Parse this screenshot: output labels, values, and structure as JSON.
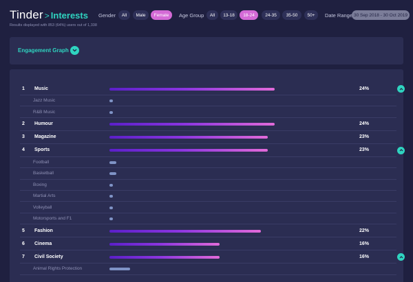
{
  "header": {
    "brand": "Tinder",
    "separator": ">",
    "section": "Interests",
    "subtitle": "Results displayed with 853 (64%) users out of 1,338"
  },
  "filters": {
    "gender_label": "Gender",
    "gender_options": [
      "All",
      "Male",
      "Female"
    ],
    "gender_selected": "Female",
    "age_label": "Age Group",
    "age_options": [
      "All",
      "13-18",
      "18-24",
      "24-35",
      "35-50",
      "50+"
    ],
    "age_selected": "18-24",
    "date_label": "Date Range",
    "date_value": "30 Sep 2018 - 30 Oct 2019"
  },
  "engagement": {
    "title": "Engagement Graph",
    "toggle_icon": "chevron-down-icon"
  },
  "colors": {
    "accent": "#2fd4c0",
    "active_pill": "#d46ad6",
    "bar_start": "#5b1fc9",
    "bar_end": "#e26ad9",
    "sub_bar": "#7f93c6"
  },
  "interests": [
    {
      "type": "main",
      "rank": "1",
      "name": "Music",
      "value": 0.24,
      "pct": "24%",
      "expanded": true
    },
    {
      "type": "sub",
      "name": "Jazz Music",
      "value": 0.005
    },
    {
      "type": "sub",
      "name": "R&B Music",
      "value": 0.005
    },
    {
      "type": "main",
      "rank": "2",
      "name": "Humour",
      "value": 0.24,
      "pct": "24%"
    },
    {
      "type": "main",
      "rank": "3",
      "name": "Magazine",
      "value": 0.23,
      "pct": "23%"
    },
    {
      "type": "main",
      "rank": "4",
      "name": "Sports",
      "value": 0.23,
      "pct": "23%",
      "expanded": true
    },
    {
      "type": "sub",
      "name": "Football",
      "value": 0.01
    },
    {
      "type": "sub",
      "name": "Basketball",
      "value": 0.01
    },
    {
      "type": "sub",
      "name": "Boxing",
      "value": 0.005
    },
    {
      "type": "sub",
      "name": "Martial Arts",
      "value": 0.005
    },
    {
      "type": "sub",
      "name": "Volleyball",
      "value": 0.005
    },
    {
      "type": "sub",
      "name": "Motorsports and F1",
      "value": 0.005
    },
    {
      "type": "main",
      "rank": "5",
      "name": "Fashion",
      "value": 0.22,
      "pct": "22%"
    },
    {
      "type": "main",
      "rank": "6",
      "name": "Cinema",
      "value": 0.16,
      "pct": "16%"
    },
    {
      "type": "main",
      "rank": "7",
      "name": "Civil Society",
      "value": 0.16,
      "pct": "16%",
      "expanded": true
    },
    {
      "type": "sub",
      "name": "Animal Rights Protection",
      "value": 0.03
    }
  ]
}
